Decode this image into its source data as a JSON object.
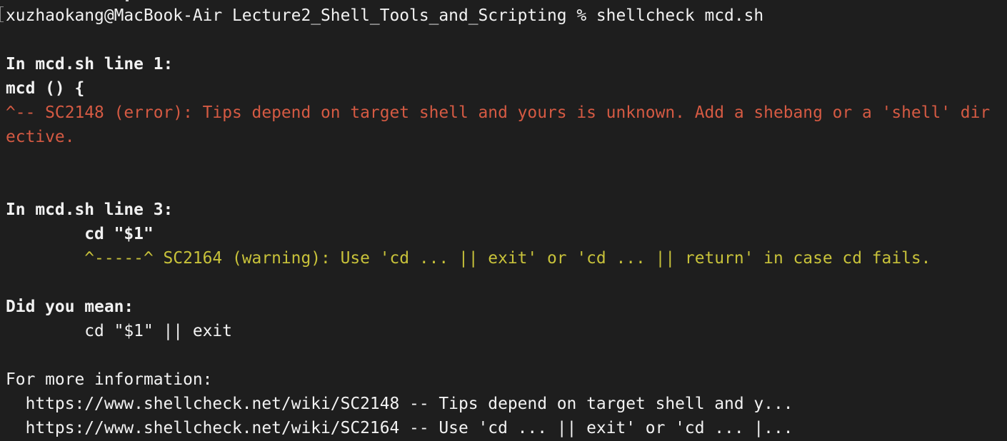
{
  "terminal": {
    "prompt_line": "xuzhaokang@MacBook-Air Lecture2_Shell_Tools_and_Scripting % shellcheck mcd.sh",
    "blocks": [
      {
        "header": "In mcd.sh line 1:",
        "code": "mcd () {",
        "message_line1": "^-- SC2148 (error): Tips depend on target shell and yours is unknown. Add a shebang or a 'shell' dir",
        "message_line2": "ective."
      },
      {
        "header": "In mcd.sh line 3:",
        "code": "        cd \"$1\"",
        "message_line1": "        ^-----^ SC2164 (warning): Use 'cd ... || exit' or 'cd ... || return' in case cd fails."
      }
    ],
    "suggestion_header": "Did you mean:",
    "suggestion_code": "        cd \"$1\" || exit",
    "info_header": "For more information:",
    "info_links": [
      "  https://www.shellcheck.net/wiki/SC2148 -- Tips depend on target shell and y...",
      "  https://www.shellcheck.net/wiki/SC2164 -- Use 'cd ... || exit' or 'cd ... |..."
    ]
  },
  "colors": {
    "background": "#1e1e1e",
    "text": "#f2f2f2",
    "error": "#d55a43",
    "warning": "#c8c23a"
  }
}
